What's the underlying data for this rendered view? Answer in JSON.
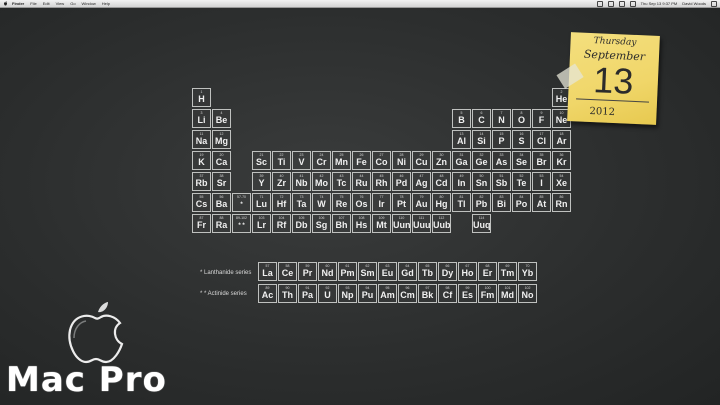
{
  "menubar": {
    "items": [
      "Finder",
      "File",
      "Edit",
      "View",
      "Go",
      "Window",
      "Help"
    ],
    "clock": "Thu Sep 13 9:37 PM",
    "user": "David Woods"
  },
  "note": {
    "day": "Thursday",
    "month": "September",
    "date": "13",
    "year": "2012"
  },
  "brand": {
    "text": "Mac Pro"
  },
  "series": {
    "lanthanide": "* Lanthanide series",
    "actinide": "* * Actinide series"
  },
  "elements": [
    {
      "n": "1",
      "s": "H",
      "c": 0,
      "r": 0
    },
    {
      "n": "3",
      "s": "Li",
      "c": 0,
      "r": 1
    },
    {
      "n": "4",
      "s": "Be",
      "c": 1,
      "r": 1
    },
    {
      "n": "11",
      "s": "Na",
      "c": 0,
      "r": 2
    },
    {
      "n": "12",
      "s": "Mg",
      "c": 1,
      "r": 2
    },
    {
      "n": "19",
      "s": "K",
      "c": 0,
      "r": 3
    },
    {
      "n": "20",
      "s": "Ca",
      "c": 1,
      "r": 3
    },
    {
      "n": "37",
      "s": "Rb",
      "c": 0,
      "r": 4
    },
    {
      "n": "38",
      "s": "Sr",
      "c": 1,
      "r": 4
    },
    {
      "n": "55",
      "s": "Cs",
      "c": 0,
      "r": 5
    },
    {
      "n": "56",
      "s": "Ba",
      "c": 1,
      "r": 5
    },
    {
      "n": "87",
      "s": "Fr",
      "c": 0,
      "r": 6
    },
    {
      "n": "88",
      "s": "Ra",
      "c": 1,
      "r": 6
    },
    {
      "n": "21",
      "s": "Sc",
      "c": 3,
      "r": 3
    },
    {
      "n": "22",
      "s": "Ti",
      "c": 4,
      "r": 3
    },
    {
      "n": "23",
      "s": "V",
      "c": 5,
      "r": 3
    },
    {
      "n": "24",
      "s": "Cr",
      "c": 6,
      "r": 3
    },
    {
      "n": "25",
      "s": "Mn",
      "c": 7,
      "r": 3
    },
    {
      "n": "26",
      "s": "Fe",
      "c": 8,
      "r": 3
    },
    {
      "n": "27",
      "s": "Co",
      "c": 9,
      "r": 3
    },
    {
      "n": "28",
      "s": "Ni",
      "c": 10,
      "r": 3
    },
    {
      "n": "29",
      "s": "Cu",
      "c": 11,
      "r": 3
    },
    {
      "n": "30",
      "s": "Zn",
      "c": 12,
      "r": 3
    },
    {
      "n": "39",
      "s": "Y",
      "c": 3,
      "r": 4
    },
    {
      "n": "40",
      "s": "Zr",
      "c": 4,
      "r": 4
    },
    {
      "n": "41",
      "s": "Nb",
      "c": 5,
      "r": 4
    },
    {
      "n": "42",
      "s": "Mo",
      "c": 6,
      "r": 4
    },
    {
      "n": "43",
      "s": "Tc",
      "c": 7,
      "r": 4
    },
    {
      "n": "44",
      "s": "Ru",
      "c": 8,
      "r": 4
    },
    {
      "n": "45",
      "s": "Rh",
      "c": 9,
      "r": 4
    },
    {
      "n": "46",
      "s": "Pd",
      "c": 10,
      "r": 4
    },
    {
      "n": "47",
      "s": "Ag",
      "c": 11,
      "r": 4
    },
    {
      "n": "48",
      "s": "Cd",
      "c": 12,
      "r": 4
    },
    {
      "n": "71",
      "s": "Lu",
      "c": 3,
      "r": 5
    },
    {
      "n": "72",
      "s": "Hf",
      "c": 4,
      "r": 5
    },
    {
      "n": "73",
      "s": "Ta",
      "c": 5,
      "r": 5
    },
    {
      "n": "74",
      "s": "W",
      "c": 6,
      "r": 5
    },
    {
      "n": "75",
      "s": "Re",
      "c": 7,
      "r": 5
    },
    {
      "n": "76",
      "s": "Os",
      "c": 8,
      "r": 5
    },
    {
      "n": "77",
      "s": "Ir",
      "c": 9,
      "r": 5
    },
    {
      "n": "78",
      "s": "Pt",
      "c": 10,
      "r": 5
    },
    {
      "n": "79",
      "s": "Au",
      "c": 11,
      "r": 5
    },
    {
      "n": "80",
      "s": "Hg",
      "c": 12,
      "r": 5
    },
    {
      "n": "103",
      "s": "Lr",
      "c": 3,
      "r": 6
    },
    {
      "n": "104",
      "s": "Rf",
      "c": 4,
      "r": 6
    },
    {
      "n": "105",
      "s": "Db",
      "c": 5,
      "r": 6
    },
    {
      "n": "106",
      "s": "Sg",
      "c": 6,
      "r": 6
    },
    {
      "n": "107",
      "s": "Bh",
      "c": 7,
      "r": 6
    },
    {
      "n": "108",
      "s": "Hs",
      "c": 8,
      "r": 6
    },
    {
      "n": "109",
      "s": "Mt",
      "c": 9,
      "r": 6
    },
    {
      "n": "110",
      "s": "Uun",
      "c": 10,
      "r": 6
    },
    {
      "n": "111",
      "s": "Uuu",
      "c": 11,
      "r": 6
    },
    {
      "n": "112",
      "s": "Uub",
      "c": 12,
      "r": 6
    },
    {
      "n": "5",
      "s": "B",
      "c": 13,
      "r": 1
    },
    {
      "n": "6",
      "s": "C",
      "c": 14,
      "r": 1
    },
    {
      "n": "7",
      "s": "N",
      "c": 15,
      "r": 1
    },
    {
      "n": "8",
      "s": "O",
      "c": 16,
      "r": 1
    },
    {
      "n": "9",
      "s": "F",
      "c": 17,
      "r": 1
    },
    {
      "n": "10",
      "s": "Ne",
      "c": 18,
      "r": 1
    },
    {
      "n": "2",
      "s": "He",
      "c": 18,
      "r": 0
    },
    {
      "n": "13",
      "s": "Al",
      "c": 13,
      "r": 2
    },
    {
      "n": "14",
      "s": "Si",
      "c": 14,
      "r": 2
    },
    {
      "n": "15",
      "s": "P",
      "c": 15,
      "r": 2
    },
    {
      "n": "16",
      "s": "S",
      "c": 16,
      "r": 2
    },
    {
      "n": "17",
      "s": "Cl",
      "c": 17,
      "r": 2
    },
    {
      "n": "18",
      "s": "Ar",
      "c": 18,
      "r": 2
    },
    {
      "n": "31",
      "s": "Ga",
      "c": 13,
      "r": 3
    },
    {
      "n": "32",
      "s": "Ge",
      "c": 14,
      "r": 3
    },
    {
      "n": "33",
      "s": "As",
      "c": 15,
      "r": 3
    },
    {
      "n": "34",
      "s": "Se",
      "c": 16,
      "r": 3
    },
    {
      "n": "35",
      "s": "Br",
      "c": 17,
      "r": 3
    },
    {
      "n": "36",
      "s": "Kr",
      "c": 18,
      "r": 3
    },
    {
      "n": "49",
      "s": "In",
      "c": 13,
      "r": 4
    },
    {
      "n": "50",
      "s": "Sn",
      "c": 14,
      "r": 4
    },
    {
      "n": "51",
      "s": "Sb",
      "c": 15,
      "r": 4
    },
    {
      "n": "52",
      "s": "Te",
      "c": 16,
      "r": 4
    },
    {
      "n": "53",
      "s": "I",
      "c": 17,
      "r": 4
    },
    {
      "n": "54",
      "s": "Xe",
      "c": 18,
      "r": 4
    },
    {
      "n": "81",
      "s": "Tl",
      "c": 13,
      "r": 5
    },
    {
      "n": "82",
      "s": "Pb",
      "c": 14,
      "r": 5
    },
    {
      "n": "83",
      "s": "Bi",
      "c": 15,
      "r": 5
    },
    {
      "n": "84",
      "s": "Po",
      "c": 16,
      "r": 5
    },
    {
      "n": "85",
      "s": "At",
      "c": 17,
      "r": 5
    },
    {
      "n": "86",
      "s": "Rn",
      "c": 18,
      "r": 5
    },
    {
      "n": "114",
      "s": "Uuq",
      "c": 14,
      "r": 6
    }
  ],
  "placeholders": [
    {
      "n": "57-70",
      "s": "*",
      "c": 2,
      "r": 5
    },
    {
      "n": "89-102",
      "s": "* *",
      "c": 2,
      "r": 6
    }
  ],
  "lanthanides": [
    {
      "n": "57",
      "s": "La"
    },
    {
      "n": "58",
      "s": "Ce"
    },
    {
      "n": "59",
      "s": "Pr"
    },
    {
      "n": "60",
      "s": "Nd"
    },
    {
      "n": "61",
      "s": "Pm"
    },
    {
      "n": "62",
      "s": "Sm"
    },
    {
      "n": "63",
      "s": "Eu"
    },
    {
      "n": "64",
      "s": "Gd"
    },
    {
      "n": "65",
      "s": "Tb"
    },
    {
      "n": "66",
      "s": "Dy"
    },
    {
      "n": "67",
      "s": "Ho"
    },
    {
      "n": "68",
      "s": "Er"
    },
    {
      "n": "69",
      "s": "Tm"
    },
    {
      "n": "70",
      "s": "Yb"
    }
  ],
  "actinides": [
    {
      "n": "89",
      "s": "Ac"
    },
    {
      "n": "90",
      "s": "Th"
    },
    {
      "n": "91",
      "s": "Pa"
    },
    {
      "n": "92",
      "s": "U"
    },
    {
      "n": "93",
      "s": "Np"
    },
    {
      "n": "94",
      "s": "Pu"
    },
    {
      "n": "95",
      "s": "Am"
    },
    {
      "n": "96",
      "s": "Cm"
    },
    {
      "n": "97",
      "s": "Bk"
    },
    {
      "n": "98",
      "s": "Cf"
    },
    {
      "n": "99",
      "s": "Es"
    },
    {
      "n": "100",
      "s": "Fm"
    },
    {
      "n": "101",
      "s": "Md"
    },
    {
      "n": "102",
      "s": "No"
    }
  ]
}
